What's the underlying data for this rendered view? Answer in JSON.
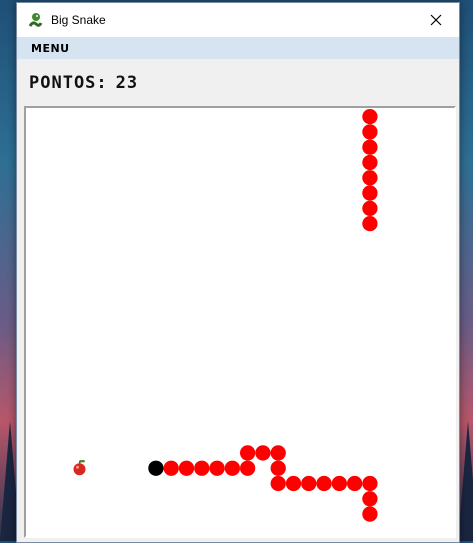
{
  "window": {
    "title": "Big Snake",
    "icon": "snake-icon"
  },
  "menu": {
    "items": [
      {
        "label": "MENU"
      }
    ]
  },
  "score": {
    "label": "PONTOS:",
    "value": "23"
  },
  "game": {
    "grid_cols": 28,
    "grid_rows": 28,
    "snake_color": "#ff0000",
    "head_color": "#000000",
    "head": [
      8,
      23
    ],
    "body": [
      [
        9,
        23
      ],
      [
        10,
        23
      ],
      [
        11,
        23
      ],
      [
        12,
        23
      ],
      [
        13,
        23
      ],
      [
        14,
        23
      ],
      [
        14,
        22
      ],
      [
        15,
        22
      ],
      [
        16,
        22
      ],
      [
        16,
        23
      ],
      [
        16,
        24
      ],
      [
        17,
        24
      ],
      [
        18,
        24
      ],
      [
        19,
        24
      ],
      [
        20,
        24
      ],
      [
        21,
        24
      ],
      [
        22,
        24
      ],
      [
        22,
        25
      ],
      [
        22,
        26
      ],
      [
        22,
        0
      ],
      [
        22,
        1
      ],
      [
        22,
        2
      ],
      [
        22,
        3
      ],
      [
        22,
        4
      ],
      [
        22,
        5
      ],
      [
        22,
        6
      ],
      [
        22,
        7
      ]
    ],
    "food": {
      "icon": "apple-icon",
      "cell": [
        3,
        23
      ]
    }
  }
}
